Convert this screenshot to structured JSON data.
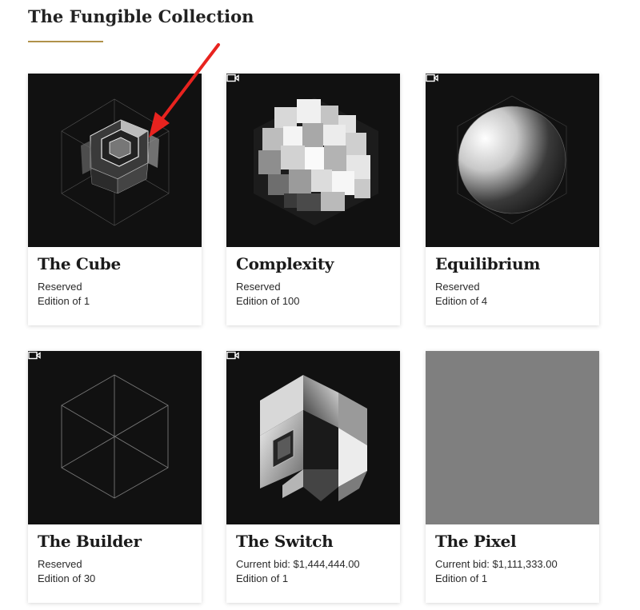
{
  "page": {
    "title": "The Fungible Collection"
  },
  "cards": [
    {
      "name": "The Cube",
      "line1": "Reserved",
      "line2": "Edition of 1",
      "has_video": false,
      "art": "cube-art"
    },
    {
      "name": "Complexity",
      "line1": "Reserved",
      "line2": "Edition of 100",
      "has_video": true,
      "art": "complexity-art"
    },
    {
      "name": "Equilibrium",
      "line1": "Reserved",
      "line2": "Edition of 4",
      "has_video": true,
      "art": "equilibrium-art"
    },
    {
      "name": "The Builder",
      "line1": "Reserved",
      "line2": "Edition of 30",
      "has_video": true,
      "art": "builder-art"
    },
    {
      "name": "The Switch",
      "line1": "Current bid: $1,444,444.00",
      "line2": "Edition of 1",
      "has_video": true,
      "art": "switch-art"
    },
    {
      "name": "The Pixel",
      "line1": "Current bid: $1,111,333.00",
      "line2": "Edition of 1",
      "has_video": false,
      "art": "pixel-art"
    }
  ],
  "colors": {
    "accent": "#b0924a",
    "art_background": "#111111",
    "pixel_gray": "#7f7f7f",
    "annotation_arrow": "#e8231f"
  },
  "icons": {
    "video": "video-camera-icon",
    "annotation": "red-arrow-annotation"
  }
}
